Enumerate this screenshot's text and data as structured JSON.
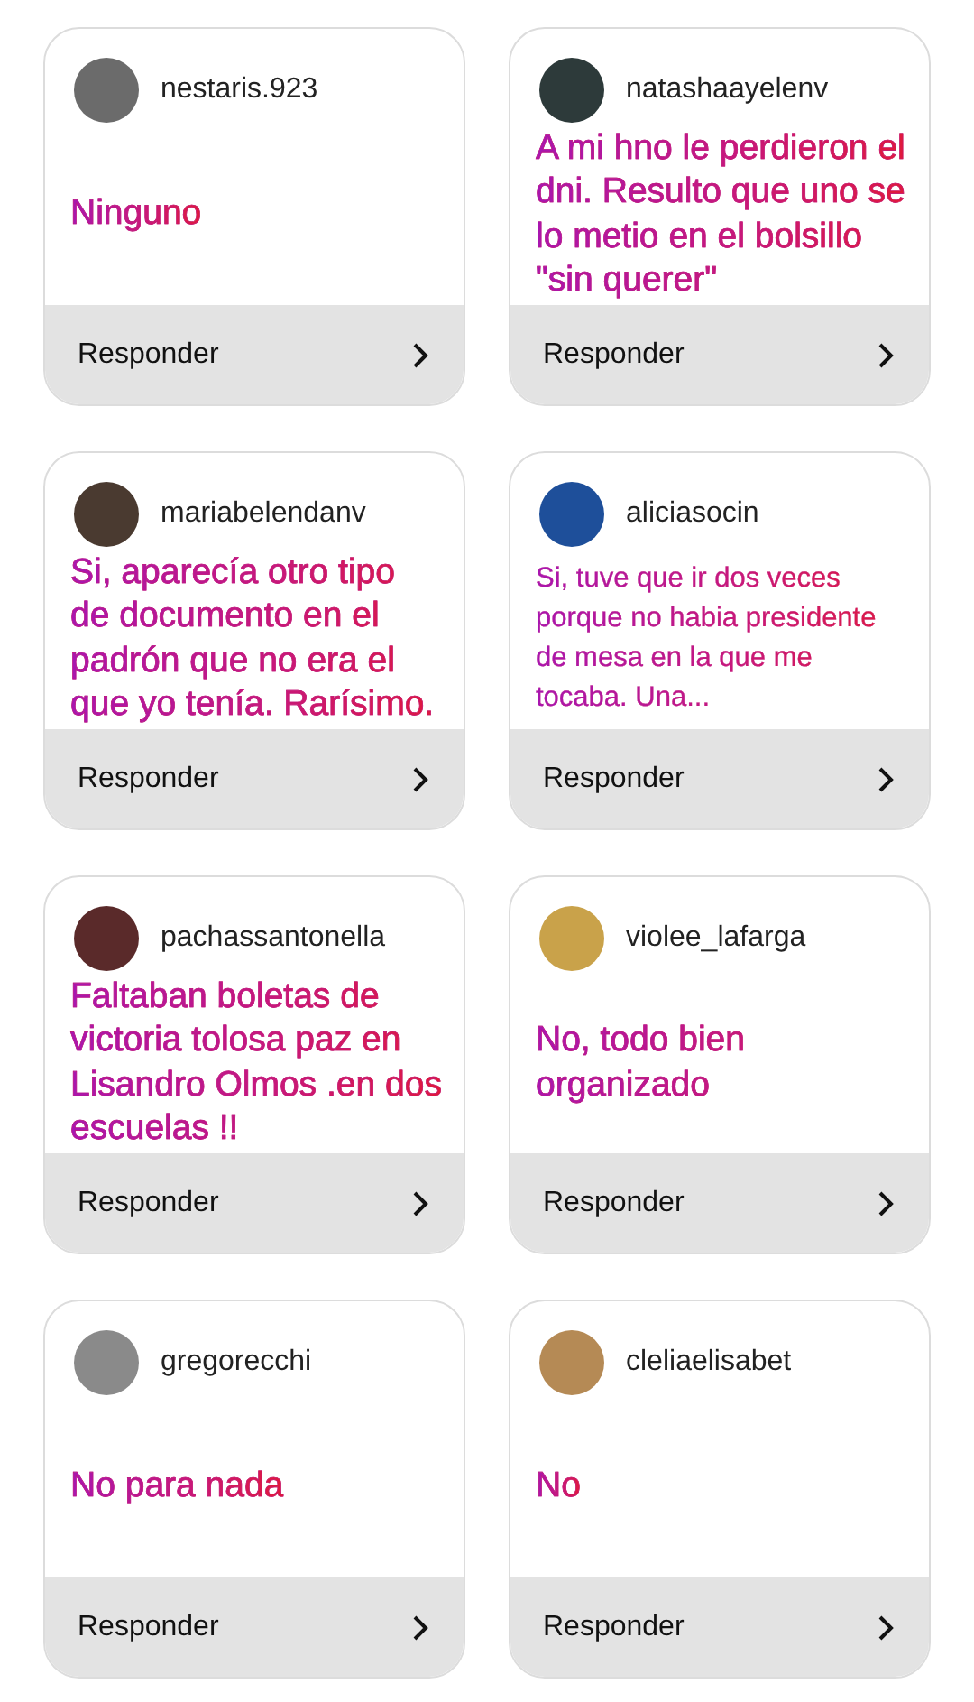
{
  "responses": [
    {
      "username": "nestaris.923",
      "answer": "Ninguno",
      "kind": "large",
      "button": "Responder"
    },
    {
      "username": "natashaayelenv",
      "answer": "A mi hno le perdieron el dni. Resulto que uno se lo metio en el bolsillo \"sin querer\"",
      "kind": "large",
      "button": "Responder"
    },
    {
      "username": "mariabelendanv",
      "answer": "Si, aparecía otro tipo de documento en el padrón que no era el que yo tenía. Rarísimo.",
      "kind": "large",
      "button": "Responder"
    },
    {
      "username": "aliciasocin",
      "answer": "Si, tuve que ir dos veces porque no habia presidente de mesa en la que me tocaba. Una...",
      "kind": "small",
      "button": "Responder"
    },
    {
      "username": "pachassantonella",
      "answer": "Faltaban boletas de victoria tolosa paz en Lisandro Olmos .en dos escuelas !!",
      "kind": "large",
      "button": "Responder"
    },
    {
      "username": "violee_lafarga",
      "answer": "No, todo bien organizado",
      "kind": "large",
      "button": "Responder"
    },
    {
      "username": "gregorecchi",
      "answer": "No para nada",
      "kind": "large",
      "button": "Responder"
    },
    {
      "username": "cleliaelisabet",
      "answer": "No",
      "kind": "large",
      "button": "Responder"
    }
  ]
}
